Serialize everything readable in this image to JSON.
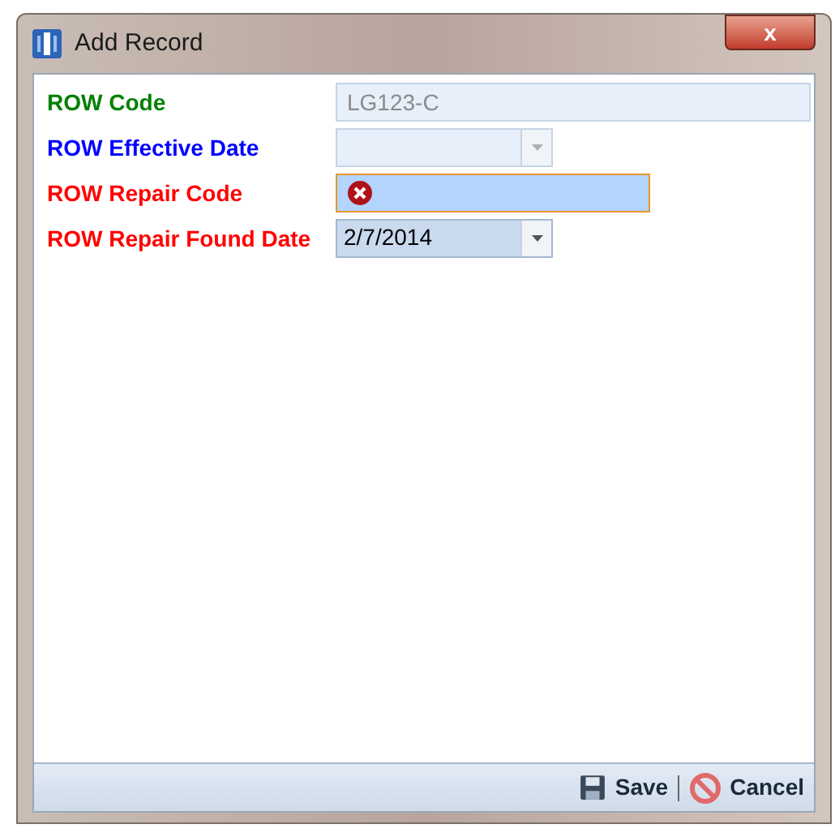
{
  "window": {
    "title": "Add Record",
    "close": "x"
  },
  "fields": [
    {
      "label": "ROW Code",
      "color": "#008000",
      "kind": "text",
      "value": "LG123-C",
      "disabled": true,
      "error": false
    },
    {
      "label": "ROW Effective Date",
      "color": "#0000ff",
      "kind": "dropdown",
      "disabled": true,
      "error": false
    },
    {
      "label": "ROW Repair Code",
      "color": "#ff0000",
      "kind": "text",
      "disabled": false,
      "error": true
    },
    {
      "label": "ROW Repair Found Date",
      "color": "#ff0000",
      "kind": "dropdown",
      "value": "2/7/2014",
      "disabled": false,
      "error": false
    }
  ],
  "buttons": [
    {
      "kind": "save",
      "label": "Save"
    },
    {
      "kind": "cancel",
      "label": "Cancel"
    }
  ]
}
